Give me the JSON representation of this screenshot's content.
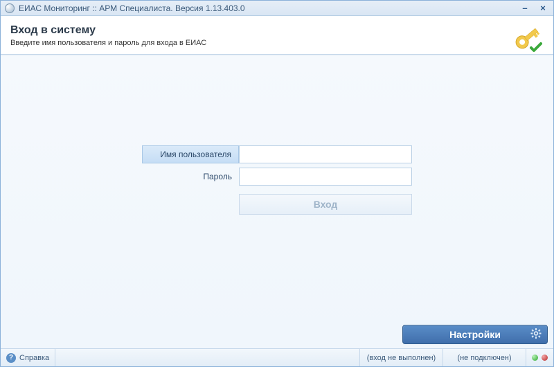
{
  "window": {
    "title": "ЕИАС Мониторинг :: АРМ Специалиста. Версия 1.13.403.0"
  },
  "header": {
    "title": "Вход в систему",
    "subtitle": "Введите имя пользователя и пароль для входа в ЕИАС"
  },
  "form": {
    "username_label": "Имя пользователя",
    "username_value": "",
    "password_label": "Пароль",
    "password_value": "",
    "login_button": "Вход"
  },
  "settings": {
    "button": "Настройки"
  },
  "status": {
    "help": "Справка",
    "login_state": "(вход не выполнен)",
    "connection_state": "(не подключен)"
  },
  "colors": {
    "accent": "#3f6eab",
    "led_ok": "#2aa82a",
    "led_err": "#b72a2a"
  }
}
